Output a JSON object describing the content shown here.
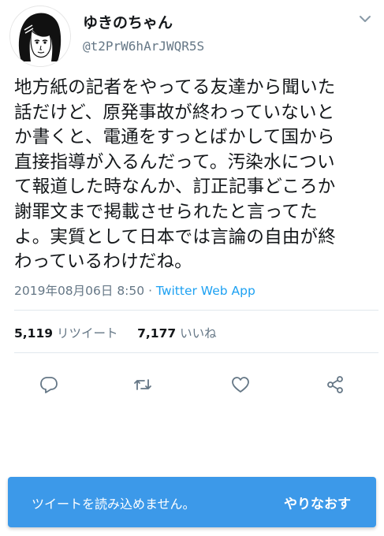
{
  "user": {
    "name": "ゆきのちゃん",
    "handle": "@t2PrW6hArJWQR5S"
  },
  "tweet": {
    "text": "地方紙の記者をやってる友達から聞いた\n話だけど、原発事故が終わっていないと\nか書くと、電通をすっとばかして国から\n直接指導が入るんだって。汚染水につい\nて報道した時なんか、訂正記事どころか\n謝罪文まで掲載させられたと言ってた\nよ。実質として日本では言論の自由が終\nわっているわけだね。",
    "timestamp": "2019年08月06日 8:50",
    "separator": " · ",
    "client": "Twitter Web App"
  },
  "stats": {
    "retweets_count": "5,119",
    "retweets_label": "リツイート",
    "likes_count": "7,177",
    "likes_label": "いいね"
  },
  "actions": {
    "icons": [
      "reply-icon",
      "retweet-icon",
      "like-icon",
      "share-icon"
    ]
  },
  "toast": {
    "message": "ツイートを読み込めません。",
    "retry_label": "やりなおす",
    "background": "#3c99e9"
  },
  "colors": {
    "text": "#14171a",
    "secondary": "#657786",
    "accent": "#1da1f2",
    "divider": "#e1e8ed"
  }
}
